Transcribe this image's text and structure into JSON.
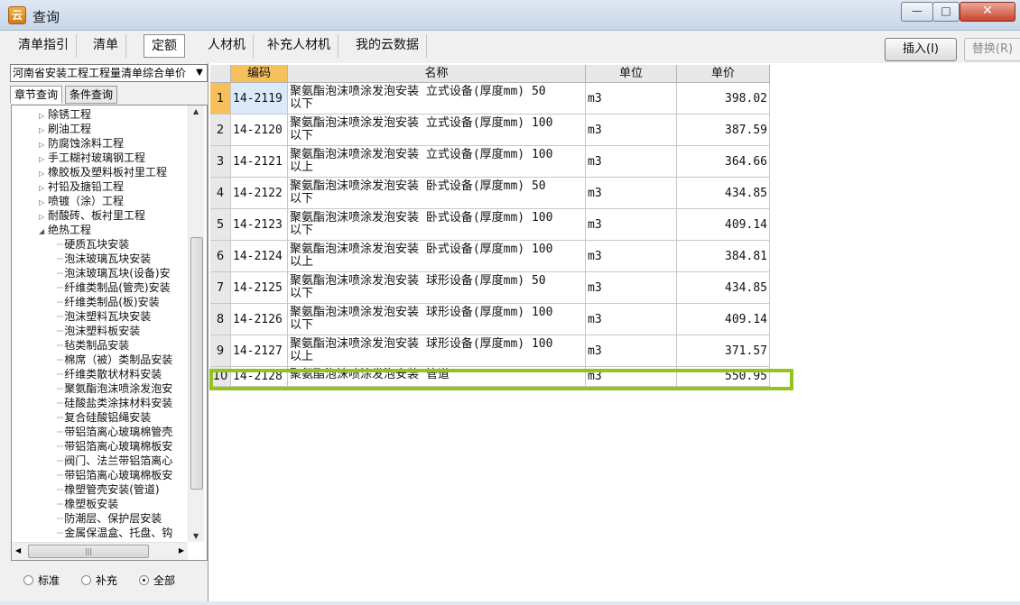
{
  "window": {
    "title": "查询",
    "icon": "app-logo-icon",
    "controls": {
      "minimize": "—",
      "maximize": "□",
      "close": "✕"
    }
  },
  "tabs": [
    {
      "label": "清单指引"
    },
    {
      "label": "清单"
    },
    {
      "label": "定额",
      "active": true
    },
    {
      "label": "人材机"
    },
    {
      "label": "补充人材机"
    },
    {
      "label": "我的云数据"
    }
  ],
  "actions": {
    "insert": "插入(I)",
    "replace": "替换(R)"
  },
  "left": {
    "library": "河南省安装工程工程量清单综合单价",
    "subtabs": [
      {
        "label": "章节查询",
        "active": true
      },
      {
        "label": "条件查询"
      }
    ],
    "tree": [
      {
        "label": "除锈工程",
        "indent": 1,
        "exp": "▷"
      },
      {
        "label": "刷油工程",
        "indent": 1,
        "exp": "▷"
      },
      {
        "label": "防腐蚀涂料工程",
        "indent": 1,
        "exp": "▷"
      },
      {
        "label": "手工糊衬玻璃钢工程",
        "indent": 1,
        "exp": "▷"
      },
      {
        "label": "橡胶板及塑料板衬里工程",
        "indent": 1,
        "exp": "▷"
      },
      {
        "label": "衬铅及搪铅工程",
        "indent": 1,
        "exp": "▷"
      },
      {
        "label": "喷镀（涂）工程",
        "indent": 1,
        "exp": "▷"
      },
      {
        "label": "耐酸砖、板衬里工程",
        "indent": 1,
        "exp": "▷"
      },
      {
        "label": "绝热工程",
        "indent": 1,
        "exp": "◢"
      },
      {
        "label": "硬质瓦块安装",
        "indent": 2
      },
      {
        "label": "泡沫玻璃瓦块安装",
        "indent": 2
      },
      {
        "label": "泡沫玻璃瓦块(设备)安",
        "indent": 2
      },
      {
        "label": "纤维类制品(管壳)安装",
        "indent": 2
      },
      {
        "label": "纤维类制品(板)安装",
        "indent": 2
      },
      {
        "label": "泡沫塑料瓦块安装",
        "indent": 2
      },
      {
        "label": "泡沫塑料板安装",
        "indent": 2
      },
      {
        "label": "毡类制品安装",
        "indent": 2
      },
      {
        "label": "棉席（被）类制品安装",
        "indent": 2
      },
      {
        "label": "纤维类散状材料安装",
        "indent": 2
      },
      {
        "label": "聚氨酯泡沫喷涂发泡安",
        "indent": 2
      },
      {
        "label": "硅酸盐类涂抹材料安装",
        "indent": 2
      },
      {
        "label": "复合硅酸铝绳安装",
        "indent": 2
      },
      {
        "label": "带铝箔离心玻璃棉管壳",
        "indent": 2
      },
      {
        "label": "带铝箔离心玻璃棉板安",
        "indent": 2
      },
      {
        "label": "阀门、法兰带铝箔离心",
        "indent": 2
      },
      {
        "label": "带铝箔离心玻璃棉板安",
        "indent": 2
      },
      {
        "label": "橡塑管壳安装(管道)",
        "indent": 2
      },
      {
        "label": "橡塑板安装",
        "indent": 2
      },
      {
        "label": "防潮层、保护层安装",
        "indent": 2
      },
      {
        "label": "金属保温盒、托盘、钩",
        "indent": 2
      }
    ],
    "filter": [
      {
        "label": "标准",
        "checked": false
      },
      {
        "label": "补充",
        "checked": false
      },
      {
        "label": "全部",
        "checked": true
      }
    ]
  },
  "grid": {
    "headers": {
      "rownum": "",
      "code": "编码",
      "name": "名称",
      "unit": "单位",
      "price": "单价"
    },
    "rows": [
      {
        "n": "1",
        "code": "14-2119",
        "name": "聚氨酯泡沫喷涂发泡安装 立式设备(厚度mm) 50\n以下",
        "unit": "m3",
        "price": "398.02"
      },
      {
        "n": "2",
        "code": "14-2120",
        "name": "聚氨酯泡沫喷涂发泡安装 立式设备(厚度mm) 100\n以下",
        "unit": "m3",
        "price": "387.59"
      },
      {
        "n": "3",
        "code": "14-2121",
        "name": "聚氨酯泡沫喷涂发泡安装 立式设备(厚度mm) 100\n以上",
        "unit": "m3",
        "price": "364.66"
      },
      {
        "n": "4",
        "code": "14-2122",
        "name": "聚氨酯泡沫喷涂发泡安装 卧式设备(厚度mm) 50\n以下",
        "unit": "m3",
        "price": "434.85"
      },
      {
        "n": "5",
        "code": "14-2123",
        "name": "聚氨酯泡沫喷涂发泡安装 卧式设备(厚度mm) 100\n以下",
        "unit": "m3",
        "price": "409.14"
      },
      {
        "n": "6",
        "code": "14-2124",
        "name": "聚氨酯泡沫喷涂发泡安装 卧式设备(厚度mm) 100\n以上",
        "unit": "m3",
        "price": "384.81"
      },
      {
        "n": "7",
        "code": "14-2125",
        "name": "聚氨酯泡沫喷涂发泡安装 球形设备(厚度mm) 50\n以下",
        "unit": "m3",
        "price": "434.85"
      },
      {
        "n": "8",
        "code": "14-2126",
        "name": "聚氨酯泡沫喷涂发泡安装 球形设备(厚度mm) 100\n以下",
        "unit": "m3",
        "price": "409.14"
      },
      {
        "n": "9",
        "code": "14-2127",
        "name": "聚氨酯泡沫喷涂发泡安装 球形设备(厚度mm) 100\n以上",
        "unit": "m3",
        "price": "371.57"
      },
      {
        "n": "10",
        "code": "14-2128",
        "name": "聚氨酯泡沫喷涂发泡安装 管道",
        "unit": "m3",
        "price": "550.95"
      }
    ],
    "selected_row": 0,
    "highlight_row": 9,
    "highlight_color": "#92c41e",
    "code_header_color": "#f6c05b"
  }
}
